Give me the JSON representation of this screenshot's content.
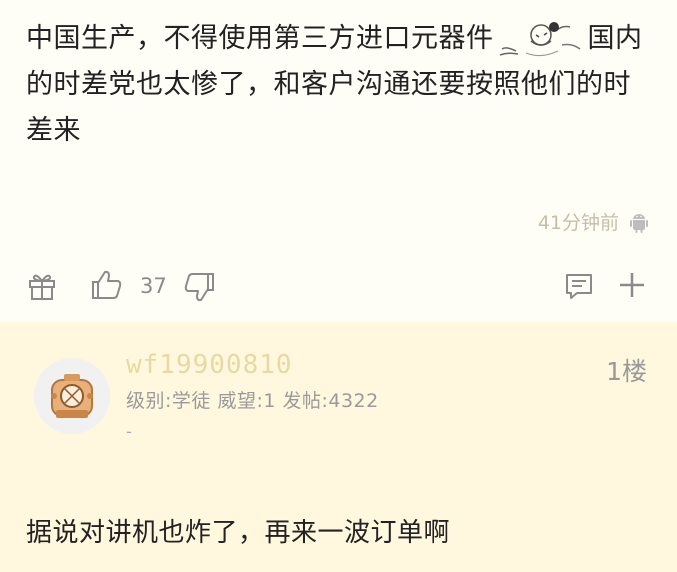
{
  "post": {
    "text_before_sticker": "中国生产，不得使用第三方进口元器件",
    "text_after_sticker": "国内的时差党也太惨了，和客户沟通还要按照他们的时差来",
    "sticker_icon": "anime-girl-sticker",
    "timestamp": "41分钟前",
    "device_icon": "android-icon",
    "like_count": "37"
  },
  "reply": {
    "username": "wf19900810",
    "floor": "1楼",
    "meta": "级别:学徒 威望:1 发帖:4322",
    "dash": "-",
    "text": "据说对讲机也炸了，再来一波订单啊",
    "avatar_icon": "diving-helmet-avatar"
  },
  "colors": {
    "post_bg": "#fffef6",
    "reply_bg": "#fff8df",
    "username": "#e8d9a2",
    "icon": "#8a8a8a"
  }
}
